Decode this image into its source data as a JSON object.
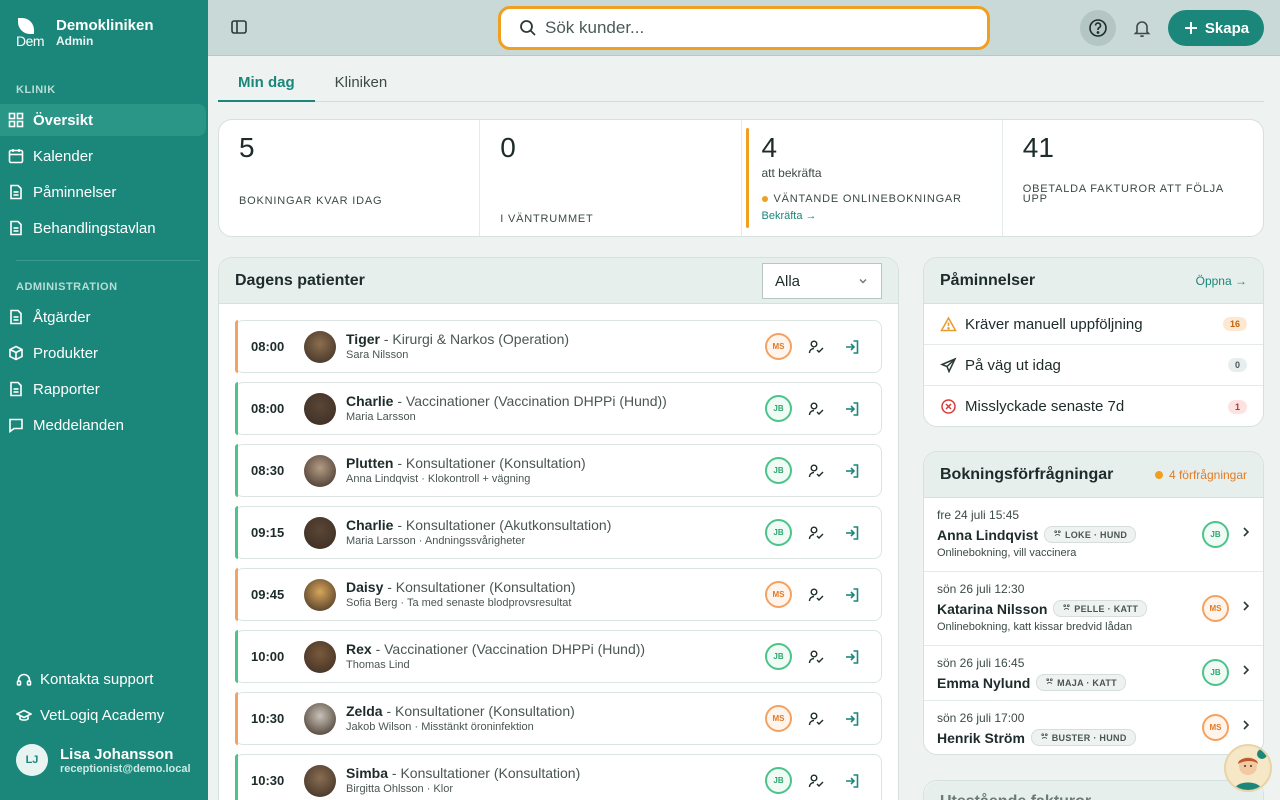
{
  "brand": {
    "name": "Demokliniken",
    "role": "Admin",
    "logo_text": "Dem"
  },
  "sidebar": {
    "section_klinik": "KLINIK",
    "klinik_items": [
      {
        "label": "Översikt",
        "icon": "grid-icon",
        "active": true
      },
      {
        "label": "Kalender",
        "icon": "calendar-icon"
      },
      {
        "label": "Påminnelser",
        "icon": "document-icon"
      },
      {
        "label": "Behandlingstavlan",
        "icon": "document-icon"
      }
    ],
    "section_admin": "ADMINISTRATION",
    "admin_items": [
      {
        "label": "Åtgärder",
        "icon": "document-icon"
      },
      {
        "label": "Produkter",
        "icon": "box-icon"
      },
      {
        "label": "Rapporter",
        "icon": "document-icon"
      },
      {
        "label": "Meddelanden",
        "icon": "message-icon"
      }
    ],
    "support": "Kontakta support",
    "academy": "VetLogiq Academy",
    "user": {
      "initials": "LJ",
      "name": "Lisa Johansson",
      "email": "receptionist@demo.local"
    }
  },
  "topbar": {
    "search_placeholder": "Sök kunder...",
    "create_label": "Skapa"
  },
  "tabs": [
    {
      "label": "Min dag",
      "active": true
    },
    {
      "label": "Kliniken",
      "active": false
    }
  ],
  "stats": [
    {
      "value": "5",
      "label": "BOKNINGAR KVAR IDAG"
    },
    {
      "value": "0",
      "label": "I VÄNTRUMMET"
    },
    {
      "value": "4",
      "sub": "att bekräfta",
      "label": "VÄNTANDE ONLINEBOKNINGAR",
      "link": "Bekräfta →"
    },
    {
      "value": "41",
      "label": "OBETALDA FAKTUROR ATT FÖLJA UPP"
    }
  ],
  "patients": {
    "title": "Dagens patienter",
    "filter": "Alla",
    "rows": [
      {
        "time": "08:00",
        "name": "Tiger",
        "detail": " - Kirurgi & Narkos (Operation)",
        "sub": "Sara Nilsson",
        "staff": "MS",
        "avatar": "#8b6e4e"
      },
      {
        "time": "08:00",
        "name": "Charlie",
        "detail": " - Vaccinationer (Vaccination DHPPi (Hund))",
        "sub": "Maria Larsson",
        "staff": "JB",
        "avatar": "#5a4636"
      },
      {
        "time": "08:30",
        "name": "Plutten",
        "detail": " - Konsultationer (Konsultation)",
        "sub": "Anna Lindqvist · Klokontroll + vägning",
        "staff": "JB",
        "avatar": "#b39c86"
      },
      {
        "time": "09:15",
        "name": "Charlie",
        "detail": " - Konsultationer (Akutkonsultation)",
        "sub": "Maria Larsson · Andningssvårigheter",
        "staff": "JB",
        "avatar": "#5a4636"
      },
      {
        "time": "09:45",
        "name": "Daisy",
        "detail": " - Konsultationer (Konsultation)",
        "sub": "Sofia Berg · Ta med senaste blodprovsresultat",
        "staff": "MS",
        "avatar": "#d8a55a"
      },
      {
        "time": "10:00",
        "name": "Rex",
        "detail": " - Vaccinationer (Vaccination DHPPi (Hund))",
        "sub": "Thomas Lind",
        "staff": "JB",
        "avatar": "#7a5a3c"
      },
      {
        "time": "10:30",
        "name": "Zelda",
        "detail": " - Konsultationer (Konsultation)",
        "sub": "Jakob Wilson · Misstänkt öroninfektion",
        "staff": "MS",
        "avatar": "#c9c2b8"
      },
      {
        "time": "10:30",
        "name": "Simba",
        "detail": " - Konsultationer (Konsultation)",
        "sub": "Birgitta Ohlsson · Klor",
        "staff": "JB",
        "avatar": "#8a6d52"
      }
    ]
  },
  "reminders": {
    "title": "Påminnelser",
    "open_link": "Öppna →",
    "items": [
      {
        "label": "Kräver manuell uppföljning",
        "count": "16",
        "icon": "warning-icon"
      },
      {
        "label": "På väg ut idag",
        "count": "0",
        "icon": "send-icon"
      },
      {
        "label": "Misslyckade senaste 7d",
        "count": "1",
        "icon": "error-icon"
      }
    ]
  },
  "requests": {
    "title": "Bokningsförfrågningar",
    "count_label": "4 förfrågningar",
    "items": [
      {
        "date": "fre 24 juli 15:45",
        "name": "Anna Lindqvist",
        "pet": "LOKE · HUND",
        "note": "Onlinebokning, vill vaccinera",
        "staff": "JB"
      },
      {
        "date": "sön 26 juli 12:30",
        "name": "Katarina Nilsson",
        "pet": "PELLE · KATT",
        "note": "Onlinebokning, katt kissar bredvid lådan",
        "staff": "MS"
      },
      {
        "date": "sön 26 juli 16:45",
        "name": "Emma Nylund",
        "pet": "MAJA · KATT",
        "note": "",
        "staff": "JB"
      },
      {
        "date": "sön 26 juli 17:00",
        "name": "Henrik Ström",
        "pet": "BUSTER · HUND",
        "note": "",
        "staff": "MS"
      }
    ]
  },
  "next_panel_title": "Utestående fakturor",
  "colors": {
    "accent": "#1a877a",
    "warning": "#f0a020",
    "ms": "#f4a261",
    "jb": "#4cc38a"
  }
}
